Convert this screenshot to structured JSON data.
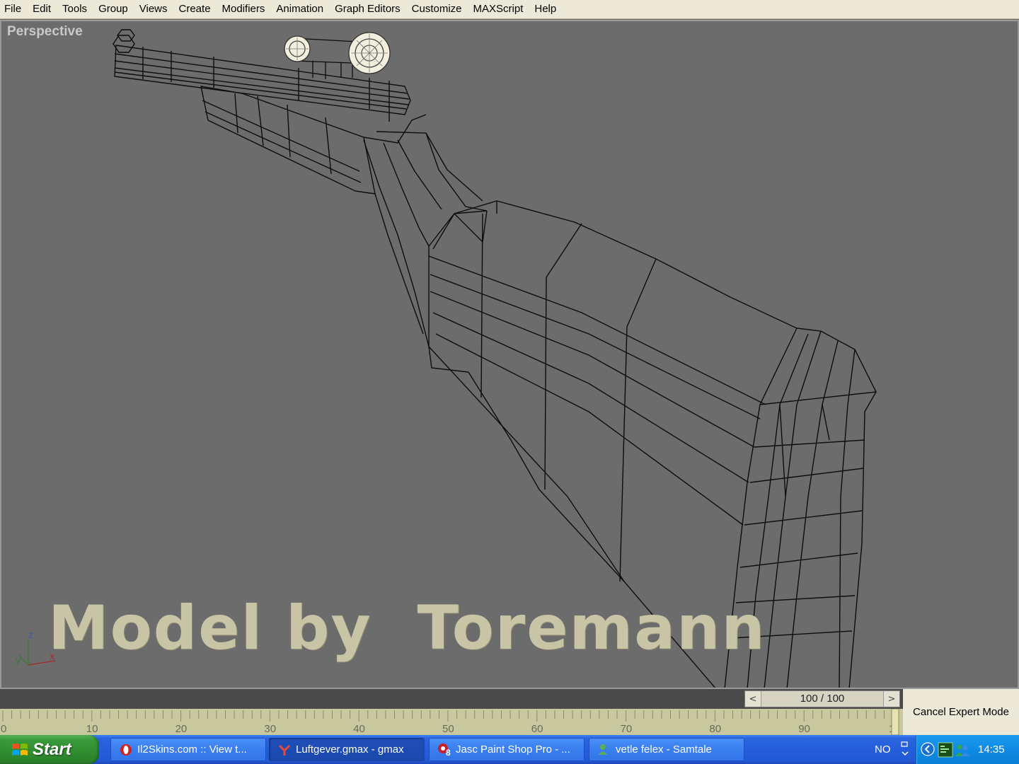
{
  "menubar": {
    "items": [
      "File",
      "Edit",
      "Tools",
      "Group",
      "Views",
      "Create",
      "Modifiers",
      "Animation",
      "Graph Editors",
      "Customize",
      "MAXScript",
      "Help"
    ]
  },
  "viewport": {
    "label": "Perspective",
    "watermark": "Model by  Toremann",
    "axis_labels": {
      "z": "z",
      "y": "y",
      "x": "x"
    },
    "colors": {
      "background": "#6c6c6c",
      "wire": "#0d0d0d",
      "scope_highlight": "#f2efdf"
    }
  },
  "time_slider": {
    "left_arrow": "<",
    "value": "100 / 100",
    "right_arrow": ">"
  },
  "trackbar": {
    "tick_labels": [
      "0",
      "10",
      "20",
      "30",
      "40",
      "50",
      "60",
      "70",
      "80",
      "90",
      "1"
    ],
    "color": "#c8c89e"
  },
  "status": {
    "cancel_expert_label": "Cancel Expert Mode"
  },
  "taskbar": {
    "start_label": "Start",
    "buttons": [
      {
        "label": "Il2Skins.com :: View t...",
        "icon": "opera-icon"
      },
      {
        "label": "Luftgever.gmax - gmax",
        "icon": "gmax-icon"
      },
      {
        "label": "Jasc Paint Shop Pro - ...",
        "icon": "paintshop-icon"
      },
      {
        "label": "vetle felex - Samtale",
        "icon": "messenger-icon"
      }
    ],
    "active_index": 1,
    "tray": {
      "language": "NO",
      "clock": "14:35",
      "badge": "8"
    }
  }
}
